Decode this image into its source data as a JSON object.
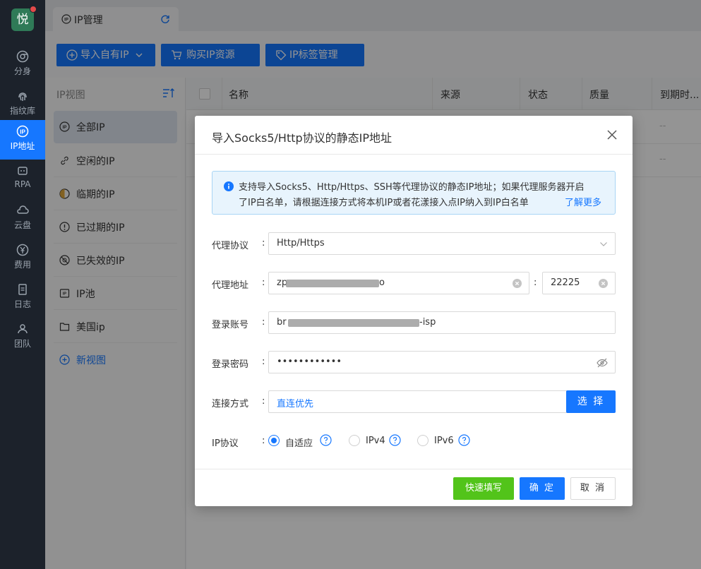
{
  "rail": {
    "logo": "悦",
    "items": [
      {
        "label": "分身",
        "icon": "chrome-icon"
      },
      {
        "label": "指纹库",
        "icon": "fingerprint-icon"
      },
      {
        "label": "IP地址",
        "icon": "ip-icon"
      },
      {
        "label": "RPA",
        "icon": "robot-icon"
      },
      {
        "label": "云盘",
        "icon": "cloud-drive-icon"
      },
      {
        "label": "费用",
        "icon": "yen-icon"
      },
      {
        "label": "日志",
        "icon": "log-icon"
      },
      {
        "label": "团队",
        "icon": "team-icon"
      }
    ],
    "active_index": 2
  },
  "tabbar": {
    "tab_label": "IP管理"
  },
  "toolbar": {
    "import_label": "导入自有IP",
    "buy_label": "购买IP资源",
    "tag_label": "IP标签管理"
  },
  "ipview": {
    "heading": "IP视图",
    "items": [
      {
        "label": "全部IP",
        "icon": "ip-icon"
      },
      {
        "label": "空闲的IP",
        "icon": "link-icon"
      },
      {
        "label": "临期的IP",
        "icon": "hourglass-icon"
      },
      {
        "label": "已过期的IP",
        "icon": "expired-icon"
      },
      {
        "label": "已失效的IP",
        "icon": "invalid-icon"
      },
      {
        "label": "IP池",
        "icon": "pool-icon"
      },
      {
        "label": "美国ip",
        "icon": "folder-icon"
      }
    ],
    "new_view_label": "新视图"
  },
  "table": {
    "columns": [
      "名称",
      "来源",
      "状态",
      "质量",
      "到期时..."
    ],
    "rows": [
      {
        "expiry": "--"
      },
      {
        "expiry": "--"
      }
    ]
  },
  "dialog": {
    "title": "导入Socks5/Http协议的静态IP地址",
    "notice_line1": "支持导入Socks5、Http/Https、SSH等代理协议的静态IP地址；如果代理服务器开启",
    "notice_line2": "了IP白名单，请根据连接方式将本机IP或者花漾接入点IP纳入到IP白名单",
    "notice_link": "了解更多",
    "colon": ":",
    "protocol": {
      "label": "代理协议",
      "value": "Http/Https"
    },
    "address": {
      "label": "代理地址",
      "host_prefix": "zp",
      "host_suffix": "o",
      "port": "22225"
    },
    "account": {
      "label": "登录账号",
      "value_prefix": "br",
      "value_suffix": "-isp"
    },
    "password": {
      "label": "登录密码",
      "masked": "••••••••••••"
    },
    "connection": {
      "label": "连接方式",
      "value": "直连优先",
      "choose_label": "选 择"
    },
    "ip_protocol": {
      "label": "IP协议",
      "options": [
        "自适应",
        "IPv4",
        "IPv6"
      ],
      "selected": "自适应"
    },
    "buttons": {
      "quick_fill": "快速填写",
      "ok": "确 定",
      "cancel": "取 消"
    }
  },
  "colors": {
    "primary": "#1677ff",
    "success": "#52c41a",
    "rail_bg": "#1c222b",
    "logo_bg": "#2f7a57",
    "notice_bg": "#e8f4fd"
  }
}
